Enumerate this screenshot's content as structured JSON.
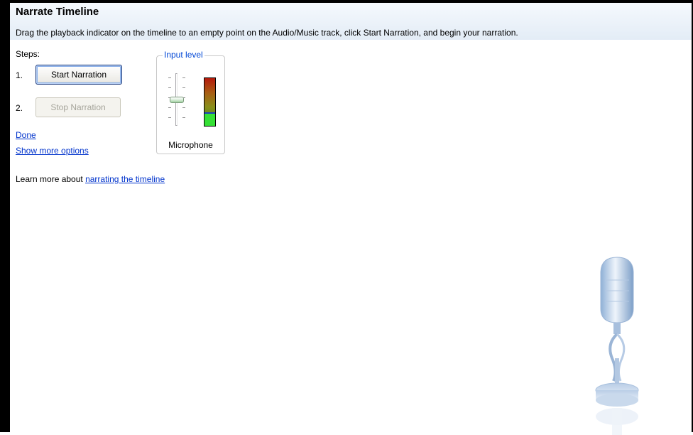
{
  "header": {
    "title": "Narrate Timeline",
    "subtitle": "Drag the playback indicator on the timeline to an empty point on the Audio/Music track, click Start Narration, and begin your narration."
  },
  "steps": {
    "label": "Steps:",
    "step1_num": "1.",
    "step1_button": "Start Narration",
    "step2_num": "2.",
    "step2_button": "Stop Narration"
  },
  "links": {
    "done": "Done",
    "show_more": "Show more options"
  },
  "learn_more": {
    "prefix": "Learn more about ",
    "link": "narrating the timeline"
  },
  "input_level": {
    "legend": "Input level",
    "device": "Microphone",
    "slider_value": 0.5,
    "meter_level": 0.26
  },
  "icons": {
    "microphone_art": "microphone-illustration-icon"
  },
  "colors": {
    "link": "#0033cc",
    "legend": "#0046d5",
    "meter_fill": "#36e036"
  }
}
